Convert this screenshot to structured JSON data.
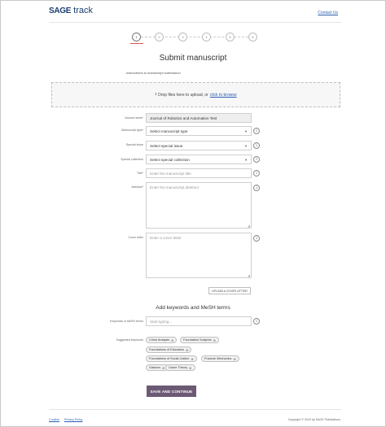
{
  "header": {
    "logo_brand": "SAGE",
    "logo_product": "track",
    "contact_link": "Contact Us"
  },
  "stepper": {
    "steps": [
      "1",
      "2",
      "3",
      "4",
      "5",
      "6"
    ],
    "active_step": 1
  },
  "page": {
    "title": "Submit manuscript",
    "instructions": "Instructions to manuscript submission"
  },
  "upload": {
    "text": "Drop files here to upload, or",
    "link": "click to browse",
    "icon": "upload-icon"
  },
  "form": {
    "journal_label": "Journal name*",
    "journal_value": "Journal of Robotics and Automation Test",
    "manuscript_type_label": "Manuscript type*",
    "manuscript_type_value": "Select manuscript type",
    "special_issue_label": "Special issue",
    "special_issue_value": "Select special issue",
    "special_collection_label": "Special collection",
    "special_collection_value": "Select special collection",
    "title_label": "Title*",
    "title_placeholder": "Enter the manuscript title",
    "abstract_label": "Abstract*",
    "abstract_placeholder": "Enter the manuscript abstract",
    "cover_letter_label": "Cover letter",
    "cover_letter_placeholder": "Enter a cover letter",
    "upload_cover_button": "UPLOAD A COVER LETTER"
  },
  "keywords": {
    "section_title": "Add keywords and MeSH terms",
    "field_label": "Keywords or MeSH terms",
    "field_placeholder": "Start typing...",
    "suggested_label": "Suggested keywords",
    "suggested": [
      "Crime Analysis",
      "Foundation Subjects",
      "Foundations of Education",
      "Foundations of Social Justice",
      "Fracture Mechanics",
      "Gabions",
      "Game Theory"
    ]
  },
  "actions": {
    "save_label": "SAVE AND CONTINUE"
  },
  "footer": {
    "links": [
      "Cookies",
      "Privacy Policy"
    ],
    "copyright": "Copyright © 2019 by SAGE Publications"
  },
  "colors": {
    "brand": "#1b3d6d",
    "link": "#2a5db0",
    "primary_button": "#6c5a74",
    "active_step_underline": "#d9534f"
  }
}
